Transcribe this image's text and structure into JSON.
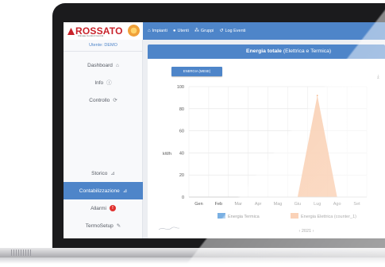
{
  "brand": {
    "name": "ROSSATO",
    "tagline": "Climate Comfort Control"
  },
  "nav": {
    "items": [
      {
        "icon": "home-icon",
        "glyph": "⌂",
        "label": "Impianti"
      },
      {
        "icon": "user-icon",
        "glyph": "●",
        "label": "Utenti"
      },
      {
        "icon": "group-icon",
        "glyph": "⁂",
        "label": "Gruppi"
      },
      {
        "icon": "history-icon",
        "glyph": "↺",
        "label": "Log Eventi"
      }
    ]
  },
  "sidebar": {
    "user": "Utente: DEMO",
    "items": [
      {
        "label": "Dashboard",
        "glyph": "⌂"
      },
      {
        "label": "Info",
        "glyph": "ⓘ"
      },
      {
        "label": "Controllo",
        "glyph": "⟳"
      },
      {
        "label": "Storico",
        "glyph": "⊿"
      },
      {
        "label": "Contabilizzazione",
        "glyph": "⊿"
      },
      {
        "label": "Allarmi",
        "glyph": "!"
      },
      {
        "label": "TermoSetup",
        "glyph": "✎"
      }
    ],
    "active_index": 4
  },
  "panel": {
    "title_main": "Energia totale",
    "title_sub": "(Elettrica e Termica)",
    "button_label": "ENERGIA (MESE)",
    "download_glyph": "⤓"
  },
  "chart_data": {
    "type": "area",
    "categories": [
      "Gen",
      "Feb",
      "Mar",
      "Apr",
      "Mag",
      "Giu",
      "Lug",
      "Ago",
      "Set"
    ],
    "ylabel": "kWh",
    "yticks": [
      0,
      20,
      40,
      60,
      80,
      100
    ],
    "ylim": [
      0,
      100
    ],
    "grid": true,
    "series": [
      {
        "name": "Energia Termica",
        "color": "#7ab0e3",
        "values": [
          0,
          0,
          0,
          0,
          0,
          0,
          0,
          0,
          0
        ]
      },
      {
        "name": "Energia Elettrica (counter_1)",
        "color": "#f5a26a",
        "values": [
          0,
          0,
          0,
          0,
          0,
          0,
          92,
          0,
          0
        ]
      }
    ],
    "legend": "bottom",
    "navigator_label": "‹ 2021 ›"
  },
  "colors": {
    "primary": "#4e85c9",
    "alarm": "#e0312e",
    "brand": "#c8222a"
  }
}
